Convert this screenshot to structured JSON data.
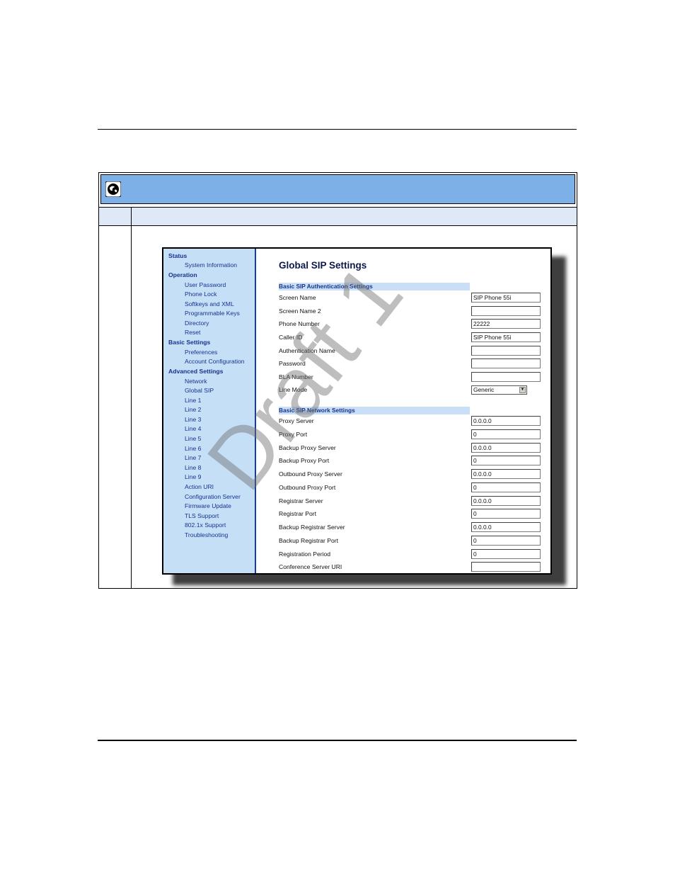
{
  "nav": {
    "status": "Status",
    "system_information": "System Information",
    "operation": "Operation",
    "user_password": "User Password",
    "phone_lock": "Phone Lock",
    "softkeys_and_xml": "Softkeys and XML",
    "programmable_keys": "Programmable Keys",
    "directory": "Directory",
    "reset": "Reset",
    "basic_settings": "Basic Settings",
    "preferences": "Preferences",
    "account_configuration": "Account Configuration",
    "advanced_settings": "Advanced Settings",
    "network": "Network",
    "global_sip": "Global SIP",
    "line1": "Line 1",
    "line2": "Line 2",
    "line3": "Line 3",
    "line4": "Line 4",
    "line5": "Line 5",
    "line6": "Line 6",
    "line7": "Line 7",
    "line8": "Line 8",
    "line9": "Line 9",
    "action_uri": "Action URI",
    "configuration_server": "Configuration Server",
    "firmware_update": "Firmware Update",
    "tls_support": "TLS Support",
    "dot1x_support": "802.1x Support",
    "troubleshooting": "Troubleshooting"
  },
  "page": {
    "title": "Global SIP Settings",
    "auth_section": "Basic SIP Authentication Settings",
    "network_section": "Basic SIP Network Settings"
  },
  "fields": {
    "screen_name": {
      "label": "Screen Name",
      "value": "SIP Phone 55i"
    },
    "screen_name2": {
      "label": "Screen Name 2",
      "value": ""
    },
    "phone_number": {
      "label": "Phone Number",
      "value": "22222"
    },
    "caller_id": {
      "label": "Caller ID",
      "value": "SIP Phone 55i"
    },
    "auth_name": {
      "label": "Authentication Name",
      "value": ""
    },
    "password": {
      "label": "Password",
      "value": ""
    },
    "bla_number": {
      "label": "BLA Number",
      "value": ""
    },
    "line_mode": {
      "label": "Line Mode",
      "value": "Generic"
    },
    "proxy_server": {
      "label": "Proxy Server",
      "value": "0.0.0.0"
    },
    "proxy_port": {
      "label": "Proxy Port",
      "value": "0"
    },
    "backup_proxy_server": {
      "label": "Backup Proxy Server",
      "value": "0.0.0.0"
    },
    "backup_proxy_port": {
      "label": "Backup Proxy Port",
      "value": "0"
    },
    "outbound_proxy_server": {
      "label": "Outbound Proxy Server",
      "value": "0.0.0.0"
    },
    "outbound_proxy_port": {
      "label": "Outbound Proxy Port",
      "value": "0"
    },
    "registrar_server": {
      "label": "Registrar Server",
      "value": "0.0.0.0"
    },
    "registrar_port": {
      "label": "Registrar Port",
      "value": "0"
    },
    "backup_registrar_server": {
      "label": "Backup Registrar Server",
      "value": "0.0.0.0"
    },
    "backup_registrar_port": {
      "label": "Backup Registrar Port",
      "value": "0"
    },
    "registration_period": {
      "label": "Registration Period",
      "value": "0"
    },
    "conference_server_uri": {
      "label": "Conference Server URI",
      "value": ""
    }
  },
  "watermark": "Draft 1",
  "icons": {
    "header": "globe-icon",
    "select_arrow": "dropdown-arrow-icon"
  }
}
